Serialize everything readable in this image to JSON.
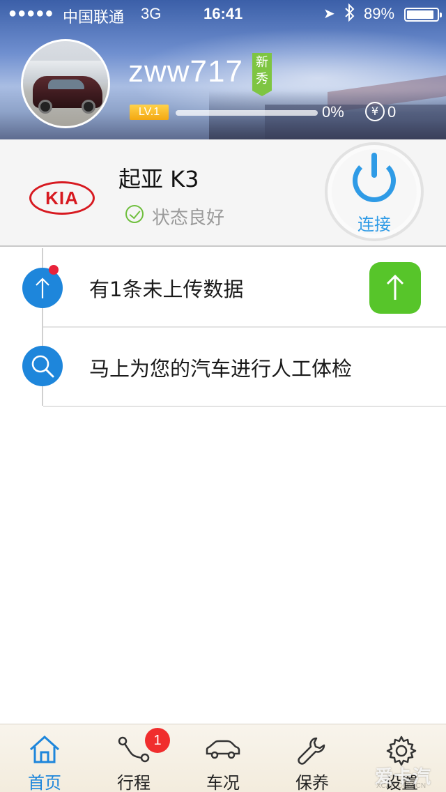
{
  "status_bar": {
    "signal": "●●●●●",
    "carrier": "中国联通",
    "network": "3G",
    "time": "16:41",
    "battery_percent": "89%",
    "battery_level": 0.89
  },
  "profile": {
    "username": "zww717",
    "badge": "新秀",
    "level": "LV.1",
    "progress_text": "0%",
    "progress_value": 0,
    "coin_symbol": "¥",
    "coins": "0"
  },
  "car": {
    "brand_logo": "KIA",
    "name": "起亚 K3",
    "status": "状态良好",
    "connect_label": "连接"
  },
  "list": {
    "upload_text": "有1条未上传数据",
    "check_text": "马上为您的汽车进行人工体检"
  },
  "tabs": [
    {
      "label": "首页",
      "icon": "home-icon",
      "active": true
    },
    {
      "label": "行程",
      "icon": "route-icon",
      "badge": "1"
    },
    {
      "label": "车况",
      "icon": "car-icon"
    },
    {
      "label": "保养",
      "icon": "wrench-icon"
    },
    {
      "label": "设置",
      "icon": "gear-icon"
    }
  ],
  "watermark": "爱卡汽车",
  "watermark_sub": "XCAR.COM.CN",
  "colors": {
    "accent": "#1e86db",
    "upload_green": "#57c52a",
    "badge_red": "#f02d2d",
    "kia_red": "#d71920"
  }
}
